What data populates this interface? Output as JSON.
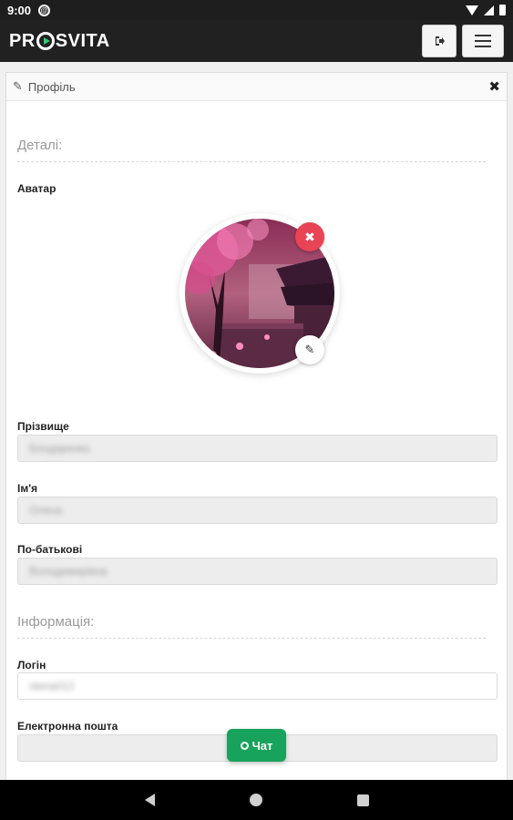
{
  "statusbar": {
    "time": "9:00",
    "app_icon": "app-notification-icon"
  },
  "appbar": {
    "logo": {
      "part1": "PR",
      "part2": "SVITA"
    },
    "logout_icon": "logout-icon",
    "menu_icon": "hamburger-menu-icon"
  },
  "panel": {
    "title": "Профіль",
    "edit_icon": "✎",
    "close_icon": "✖"
  },
  "details": {
    "section_title": "Деталі:",
    "avatar_label": "Аватар",
    "avatar_delete_icon": "✖",
    "avatar_edit_icon": "✎",
    "surname_label": "Прізвище",
    "surname_value": "Бондаренко",
    "name_label": "Ім'я",
    "name_value": "Олена",
    "patronymic_label": "По-батькові",
    "patronymic_value": "Володимирівна"
  },
  "info": {
    "section_title": "Інформація:",
    "login_label": "Логін",
    "login_value": "olena012",
    "email_label": "Електронна пошта",
    "email_value": ""
  },
  "chat": {
    "label": "Чат"
  },
  "colors": {
    "accent_green": "#17a35b",
    "delete_red": "#e94356",
    "appbar_bg": "#212121"
  }
}
